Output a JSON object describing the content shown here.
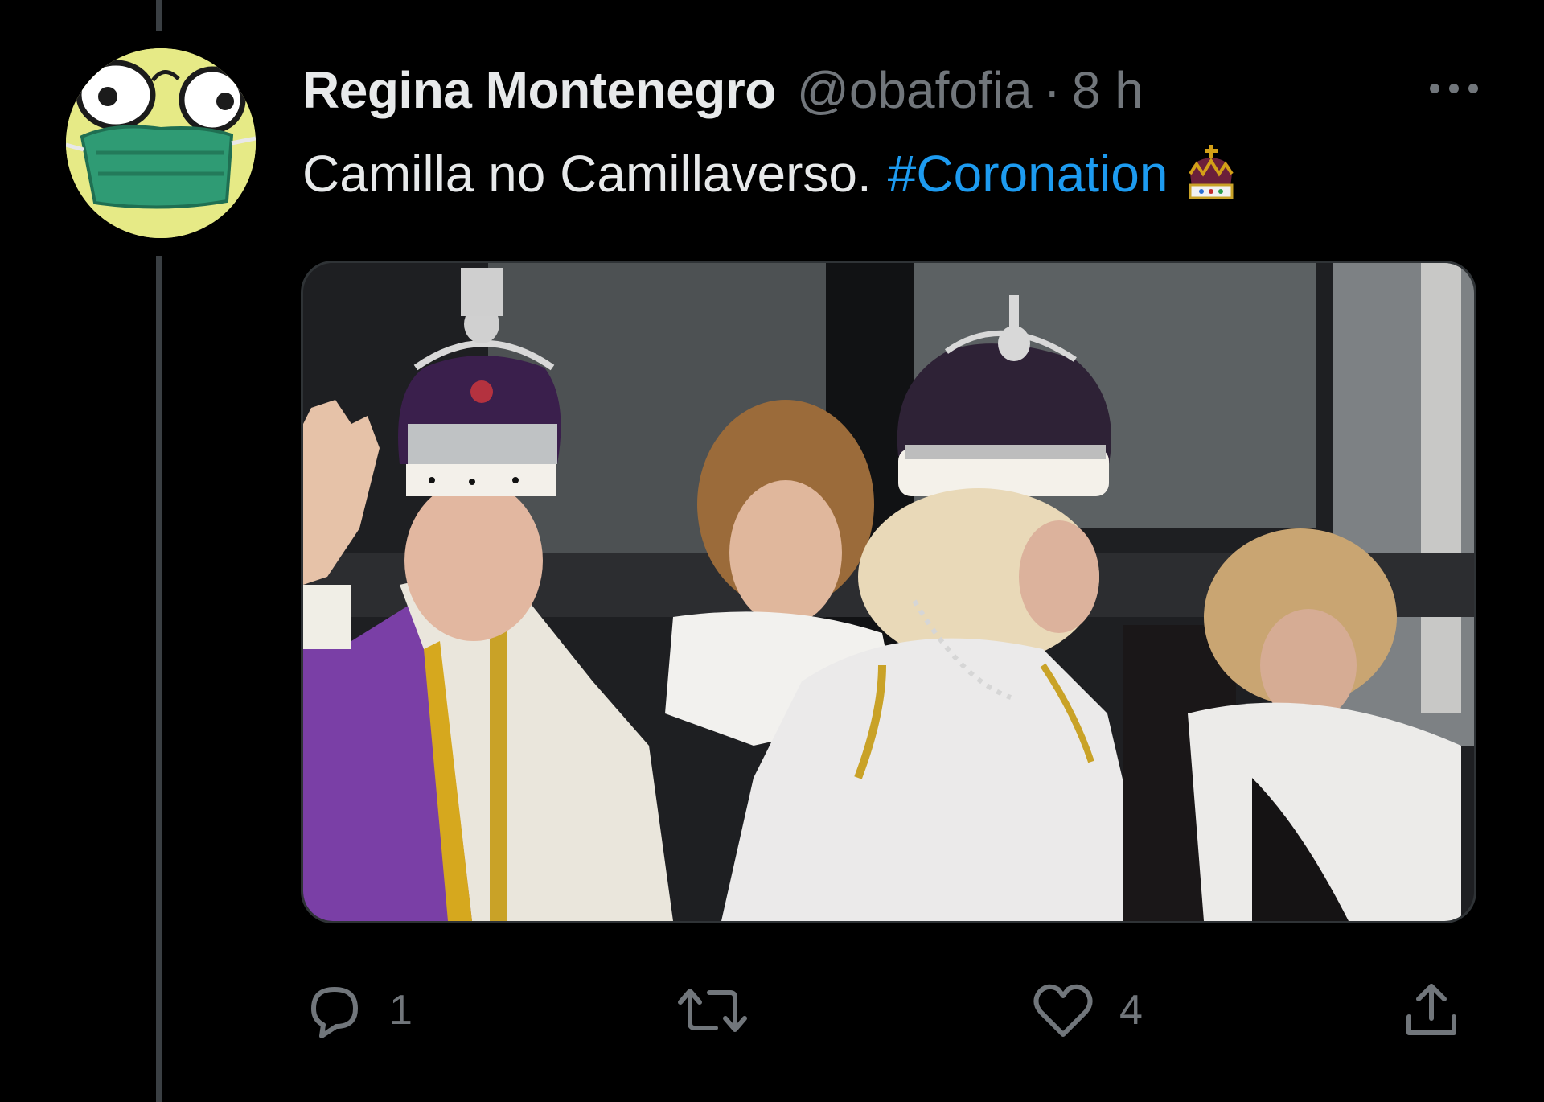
{
  "tweet": {
    "author": {
      "display_name": "Regina Montenegro",
      "handle": "@obafofia",
      "separator": "·",
      "time": "8 h",
      "avatar_icon": "cartoon-face-with-mask-avatar"
    },
    "text": "Camilla no Camillaverso.",
    "hashtag": "#Coronation",
    "emoji": "crown-emoji",
    "media": {
      "type": "photo",
      "description_icon": "coronation-balcony-photo"
    },
    "actions": {
      "reply_count": "1",
      "retweet_count": "",
      "like_count": "4"
    }
  },
  "colors": {
    "background": "#000000",
    "primary_text": "#e7e9ea",
    "secondary_text": "#71767b",
    "link": "#1d9bf0",
    "divider": "#2f3336"
  }
}
